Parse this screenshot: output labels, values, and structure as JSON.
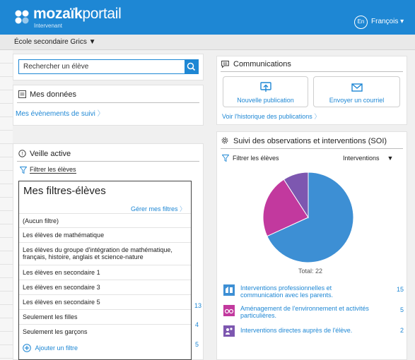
{
  "header": {
    "logo_bold": "mozaïk",
    "logo_light": "portail",
    "logo_sub": "Intervenant",
    "lang_code": "En",
    "lang_label": "François ▾",
    "bg_color": "#1e87d4"
  },
  "school": {
    "label": "École secondaire Grics ▼"
  },
  "search": {
    "placeholder": "Rechercher un élève"
  },
  "mes_donnees": {
    "title": "Mes données",
    "link": "Mes évènements de suivi",
    "chevron": "〉"
  },
  "veille": {
    "title": "Veille active",
    "filter_label": "Filtrer les élèves",
    "filters_title": "Mes filtres-élèves",
    "manage_link": "Gérer mes filtres",
    "rows": [
      "(Aucun filtre)",
      "Les élèves de mathématique",
      "Les élèves du groupe d'intégration de mathématique, français, histoire, anglais et science-nature",
      "Les élèves en secondaire 1",
      "Les élèves en secondaire 3",
      "Les élèves en secondaire 5",
      "Seulement les filles",
      "Seulement les garçons"
    ],
    "add_filter": "Ajouter un filtre",
    "counts": [
      "13",
      "4",
      "5"
    ]
  },
  "communications": {
    "title": "Communications",
    "new_publication": "Nouvelle publication",
    "send_mail": "Envoyer un courriel",
    "history_link": "Voir l'historique des publications"
  },
  "soi": {
    "title": "Suivi des observations et interventions (SOI)",
    "filter_label": "Filtrer les élèves",
    "dropdown": "Interventions",
    "dropdown_arrow": "▼",
    "total": "Total: 22"
  },
  "chart_data": {
    "type": "pie",
    "total": 22,
    "slices": [
      {
        "label": "Interventions professionnelles et communication avec les parents.",
        "value": 15,
        "color": "#3d8fd4",
        "icon": "communication-icon"
      },
      {
        "label": "Aménagement de l'environnement et activités particulières.",
        "value": 5,
        "color": "#c2399e",
        "icon": "glasses-icon"
      },
      {
        "label": "Interventions directes auprès de l'élève.",
        "value": 2,
        "color": "#7d57b0",
        "icon": "people-icon"
      }
    ]
  }
}
